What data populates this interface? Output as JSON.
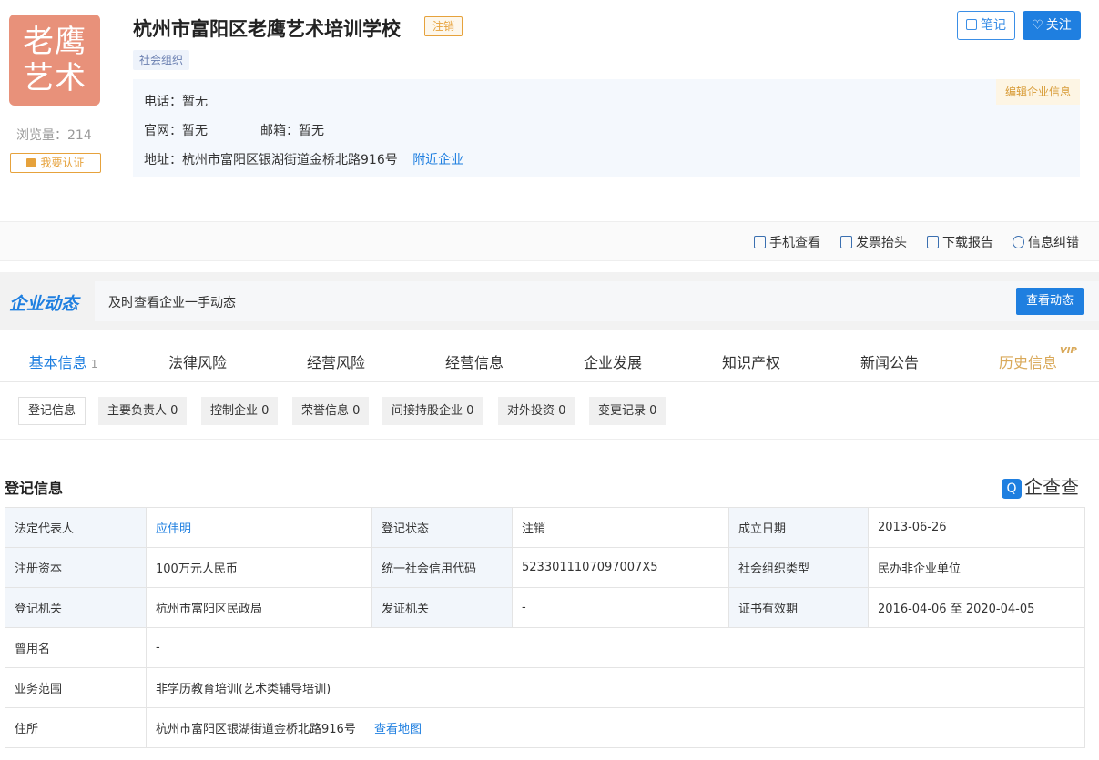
{
  "company": {
    "logo_line1": "老鹰",
    "logo_line2": "艺术",
    "name": "杭州市富阳区老鹰艺术培训学校",
    "status": "注销",
    "type": "社会组织",
    "views_label": "浏览量：",
    "views": "214",
    "certify": "我要认证"
  },
  "actions": {
    "note": "笔记",
    "follow": "关注",
    "edit_info": "编辑企业信息"
  },
  "contact": {
    "phone_label": "电话：",
    "phone": "暂无",
    "site_label": "官网：",
    "site": "暂无",
    "email_label": "邮箱：",
    "email": "暂无",
    "address_label": "地址：",
    "address": "杭州市富阳区银湖街道金桥北路916号",
    "nearby": "附近企业"
  },
  "toolbar": {
    "mobile": "手机查看",
    "invoice": "发票抬头",
    "report": "下载报告",
    "correct": "信息纠错"
  },
  "dynamics": {
    "title": "企业动态",
    "text": "及时查看企业一手动态",
    "button": "查看动态"
  },
  "tabs": [
    {
      "label": "基本信息",
      "count": "1"
    },
    {
      "label": "法律风险"
    },
    {
      "label": "经营风险"
    },
    {
      "label": "经营信息"
    },
    {
      "label": "企业发展"
    },
    {
      "label": "知识产权"
    },
    {
      "label": "新闻公告"
    },
    {
      "label": "历史信息",
      "badge": "VIP"
    }
  ],
  "subtabs": [
    "登记信息",
    "主要负责人 0",
    "控制企业 0",
    "荣誉信息 0",
    "间接持股企业 0",
    "对外投资 0",
    "变更记录 0"
  ],
  "section": {
    "title": "登记信息",
    "brand": "企查查",
    "brand_mark": "Q"
  },
  "registration": {
    "legal_rep_label": "法定代表人",
    "legal_rep": "应伟明",
    "reg_status_label": "登记状态",
    "reg_status": "注销",
    "founded_label": "成立日期",
    "founded": "2013-06-26",
    "capital_label": "注册资本",
    "capital": "100万元人民币",
    "credit_code_label": "统一社会信用代码",
    "credit_code": "5233011107097007X5",
    "org_type_label": "社会组织类型",
    "org_type": "民办非企业单位",
    "authority_label": "登记机关",
    "authority": "杭州市富阳区民政局",
    "issuer_label": "发证机关",
    "issuer": "-",
    "validity_label": "证书有效期",
    "validity": "2016-04-06 至 2020-04-05",
    "former_name_label": "曾用名",
    "former_name": "-",
    "scope_label": "业务范围",
    "scope": "非学历教育培训(艺术类辅导培训)",
    "residence_label": "住所",
    "residence": "杭州市富阳区银湖街道金桥北路916号",
    "map_link": "查看地图"
  }
}
